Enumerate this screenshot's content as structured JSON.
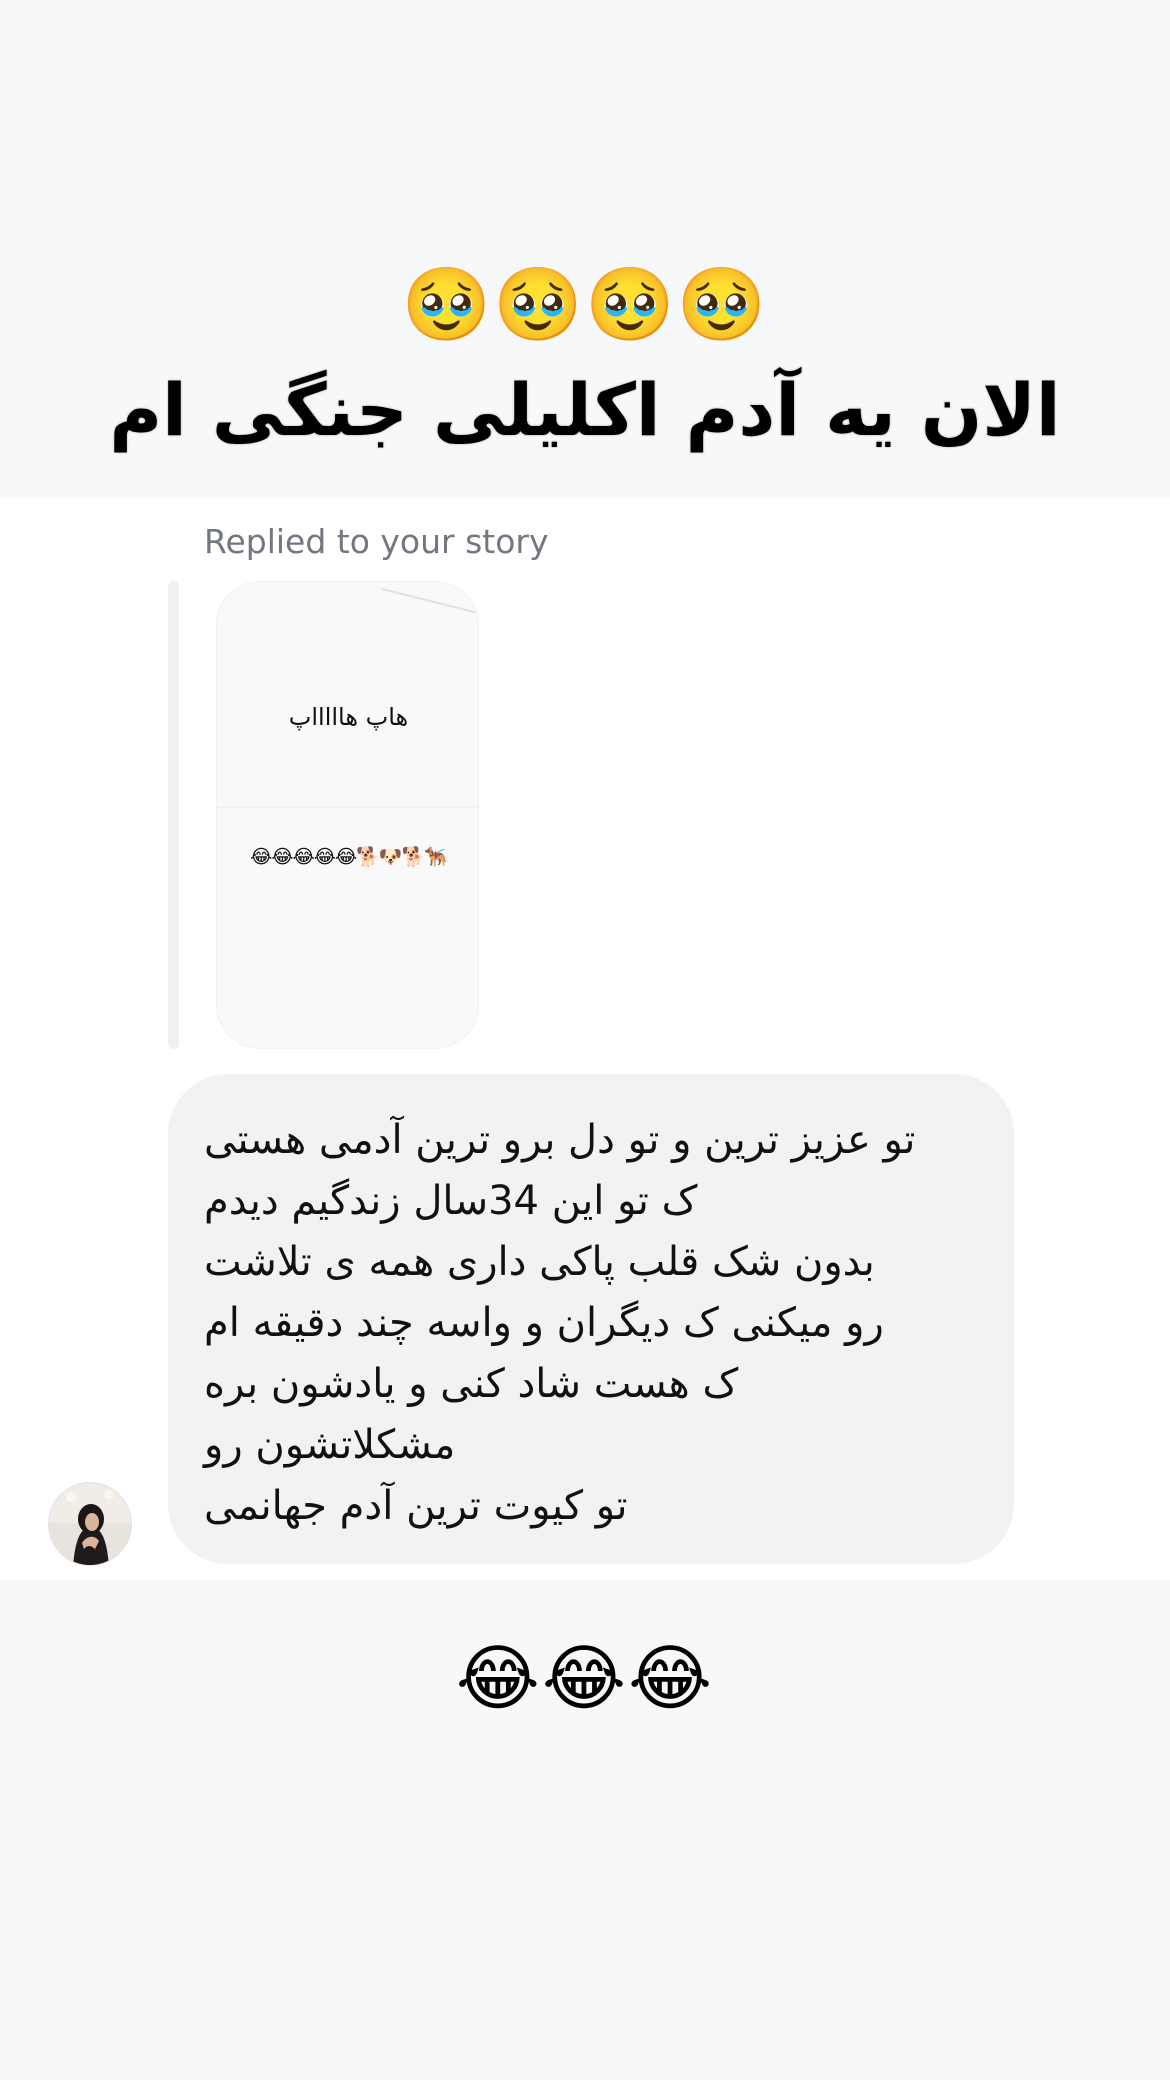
{
  "story_caption": {
    "emojis": "🥹🥹🥹🥹",
    "text": "الان یه آدم اکلیلی جنگی ام"
  },
  "reply": {
    "label": "Replied to your story",
    "story_preview": {
      "text_line1": "هاپ هاااااپ",
      "text_line2": "😂😂😂😂😂🐕🐶🐕🐕‍🦺"
    }
  },
  "message": {
    "lines": [
      "تو عزیز ترین و تو دل برو ترین آدمی هستی",
      "ک تو این 34سال زندگیم دیدم",
      "بدون شک قلب پاکی داری همه ی تلاشت",
      "رو میکنی ک دیگران و واسه چند دقیقه ام",
      "ک هست شاد کنی و یادشون بره",
      "مشکلاتشون رو",
      "تو کیوت ترین  آدم جهانمی"
    ]
  },
  "reaction_caption": {
    "emojis": "😂😂😂"
  },
  "icons": {
    "avatar": "user-avatar-photo"
  },
  "colors": {
    "background": "#f7f8fa",
    "chat_panel": "#ffffff",
    "bubble": "#f1f2f4",
    "label_gray": "#737880"
  }
}
